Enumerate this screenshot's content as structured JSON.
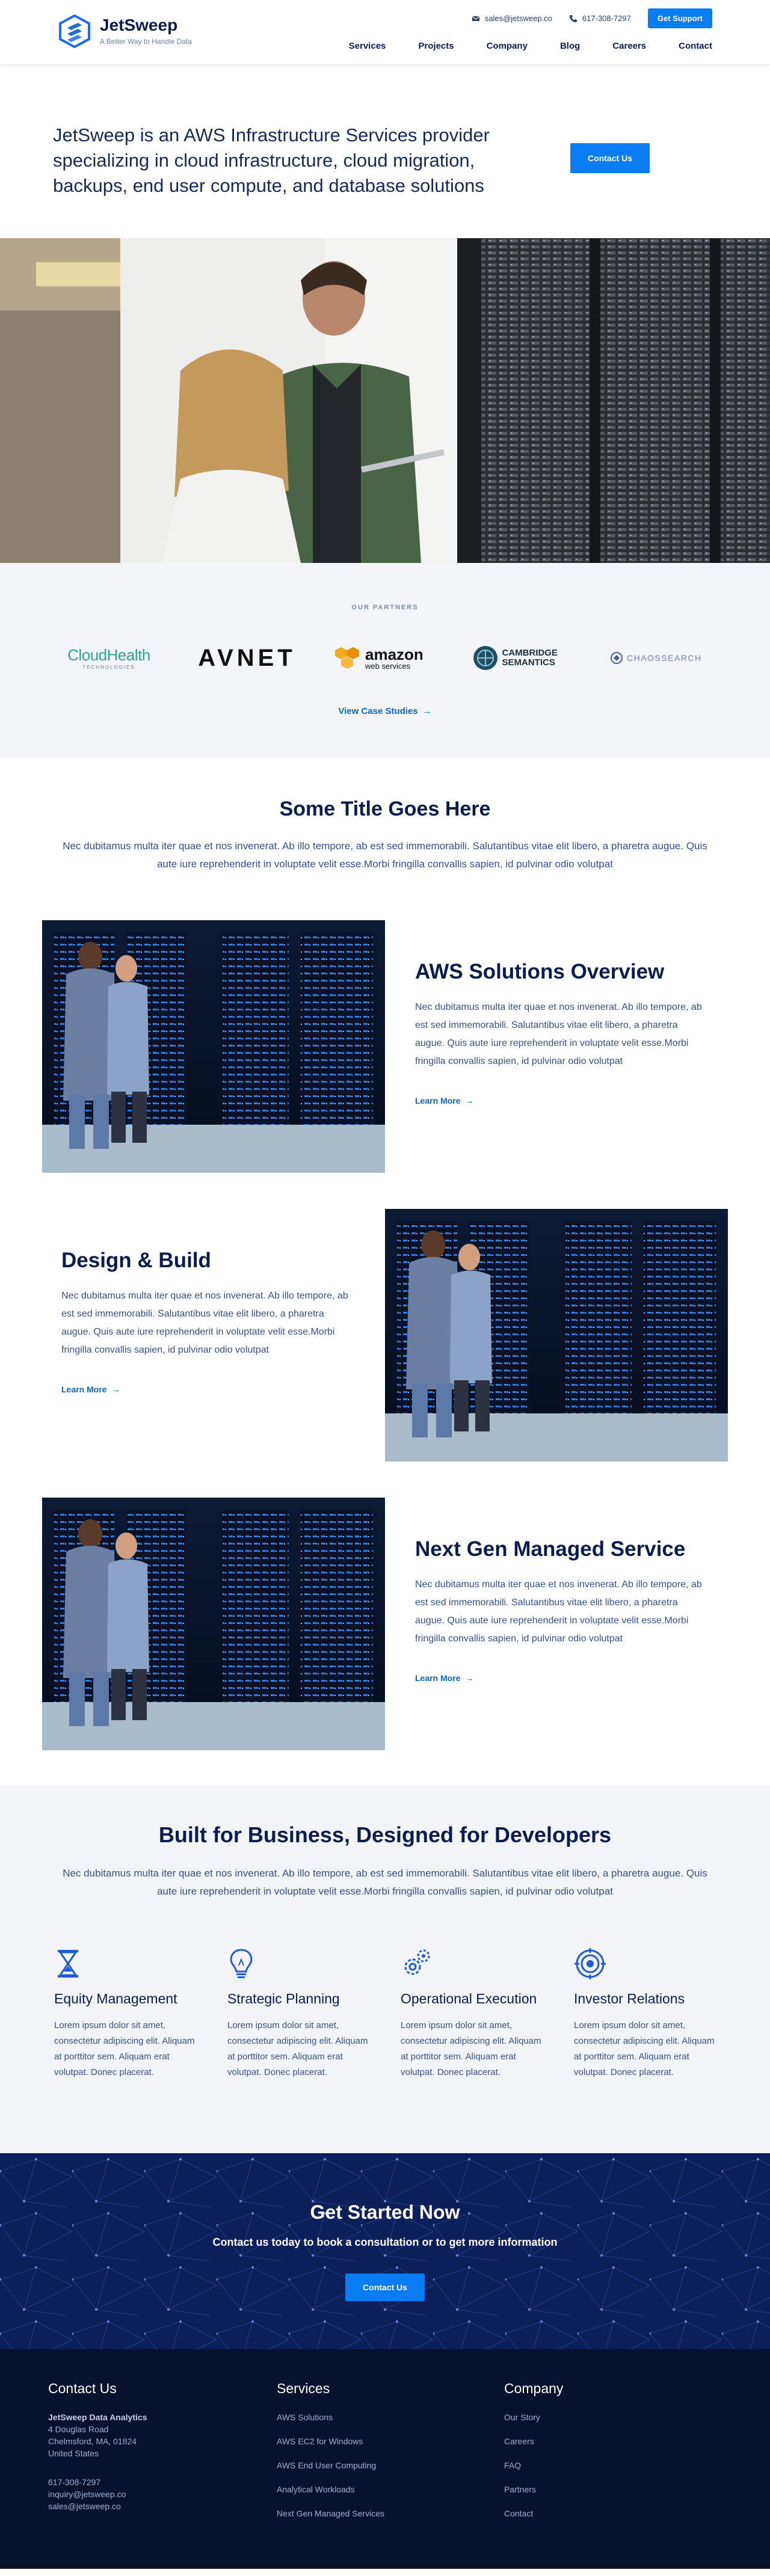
{
  "brand": {
    "name": "JetSweep",
    "tagline": "A Better Way to Handle Data"
  },
  "topbar": {
    "email": "sales@jetsweep.co",
    "phone": "617-308-7297",
    "support_label": "Get Support"
  },
  "nav": [
    "Services",
    "Projects",
    "Company",
    "Blog",
    "Careers",
    "Contact"
  ],
  "intro": {
    "text": "JetSweep is an AWS Infrastructure Services provider specializing in cloud infrastructure, cloud migration, backups, end user compute, and database solutions",
    "button": "Contact Us"
  },
  "partners": {
    "label": "OUR PARTNERS",
    "cloudhealth": "CloudHealth",
    "cloudhealth_sub": "TECHNOLOGIES",
    "avnet": "AVNET",
    "amazon": "amazon",
    "amazon_sub": "web services",
    "cambridge_1": "CAMBRIDGE",
    "cambridge_2": "SEMANTICS",
    "chaos": "CHAOSSEARCH",
    "case_link": "View Case Studies"
  },
  "title_section": {
    "title": "Some Title Goes Here",
    "text": "Nec dubitamus multa iter quae et nos invenerat. Ab illo tempore, ab est sed immemorabili. Salutantibus vitae elit libero, a pharetra augue. Quis aute iure reprehenderit in voluptate velit esse.Morbi fringilla convallis sapien, id pulvinar odio volutpat"
  },
  "rows": [
    {
      "title": "AWS Solutions Overview",
      "text": "Nec dubitamus multa iter quae et nos invenerat. Ab illo tempore, ab est sed immemorabili. Salutantibus vitae elit libero, a pharetra augue. Quis aute iure reprehenderit in voluptate velit esse.Morbi fringilla convallis sapien, id pulvinar odio volutpat",
      "link": "Learn More"
    },
    {
      "title": "Design & Build",
      "text": "Nec dubitamus multa iter quae et nos invenerat. Ab illo tempore, ab est sed immemorabili. Salutantibus vitae elit libero, a pharetra augue. Quis aute iure reprehenderit in voluptate velit esse.Morbi fringilla convallis sapien, id pulvinar odio volutpat",
      "link": "Learn More"
    },
    {
      "title": "Next Gen Managed Service",
      "text": "Nec dubitamus multa iter quae et nos invenerat. Ab illo tempore, ab est sed immemorabili. Salutantibus vitae elit libero, a pharetra augue. Quis aute iure reprehenderit in voluptate velit esse.Morbi fringilla convallis sapien, id pulvinar odio volutpat",
      "link": "Learn More"
    }
  ],
  "built": {
    "title": "Built for Business, Designed for Developers",
    "text": "Nec dubitamus multa iter quae et nos invenerat. Ab illo tempore, ab est sed immemorabili. Salutantibus vitae elit libero, a pharetra augue. Quis aute iure reprehenderit in voluptate velit esse.Morbi fringilla convallis sapien, id pulvinar odio volutpat",
    "features": [
      {
        "icon": "hourglass-icon",
        "title": "Equity Management",
        "text": "Lorem ipsum dolor sit amet, consectetur adipiscing elit. Aliquam at porttitor sem. Aliquam erat volutpat. Donec placerat."
      },
      {
        "icon": "lightbulb-icon",
        "title": "Strategic Planning",
        "text": "Lorem ipsum dolor sit amet, consectetur adipiscing elit. Aliquam at porttitor sem. Aliquam erat volutpat. Donec placerat."
      },
      {
        "icon": "gears-icon",
        "title": "Operational Execution",
        "text": "Lorem ipsum dolor sit amet, consectetur adipiscing elit. Aliquam at porttitor sem. Aliquam erat volutpat. Donec placerat."
      },
      {
        "icon": "target-icon",
        "title": "Investor Relations",
        "text": "Lorem ipsum dolor sit amet, consectetur adipiscing elit. Aliquam at porttitor sem. Aliquam erat volutpat. Donec placerat."
      }
    ]
  },
  "cta": {
    "title": "Get Started Now",
    "text": "Contact us today to book a consultation or to get more information",
    "button": "Contact Us"
  },
  "footer": {
    "contact": {
      "title": "Contact Us",
      "company": "JetSweep Data Analytics",
      "address1": "4 Douglas Road",
      "address2": "Chelmsford, MA, 01824",
      "country": "United States",
      "phone": "617-308-7297",
      "email1": "inquiry@jetsweep.co",
      "email2": "sales@jetsweep.co"
    },
    "services": {
      "title": "Services",
      "links": [
        "AWS Solutions",
        "AWS EC2 for Windows",
        "AWS End User Computing",
        "Analytical Workloads",
        "Next Gen Managed Services"
      ]
    },
    "company": {
      "title": "Company",
      "links": [
        "Our Story",
        "Careers",
        "FAQ",
        "Partners",
        "Contact"
      ]
    }
  },
  "colors": {
    "accent": "#0a7cf4",
    "navy": "#0b1d4e",
    "footer": "#08122f",
    "cta": "#0b1f5a",
    "muted_bg": "#f4f5f8"
  }
}
